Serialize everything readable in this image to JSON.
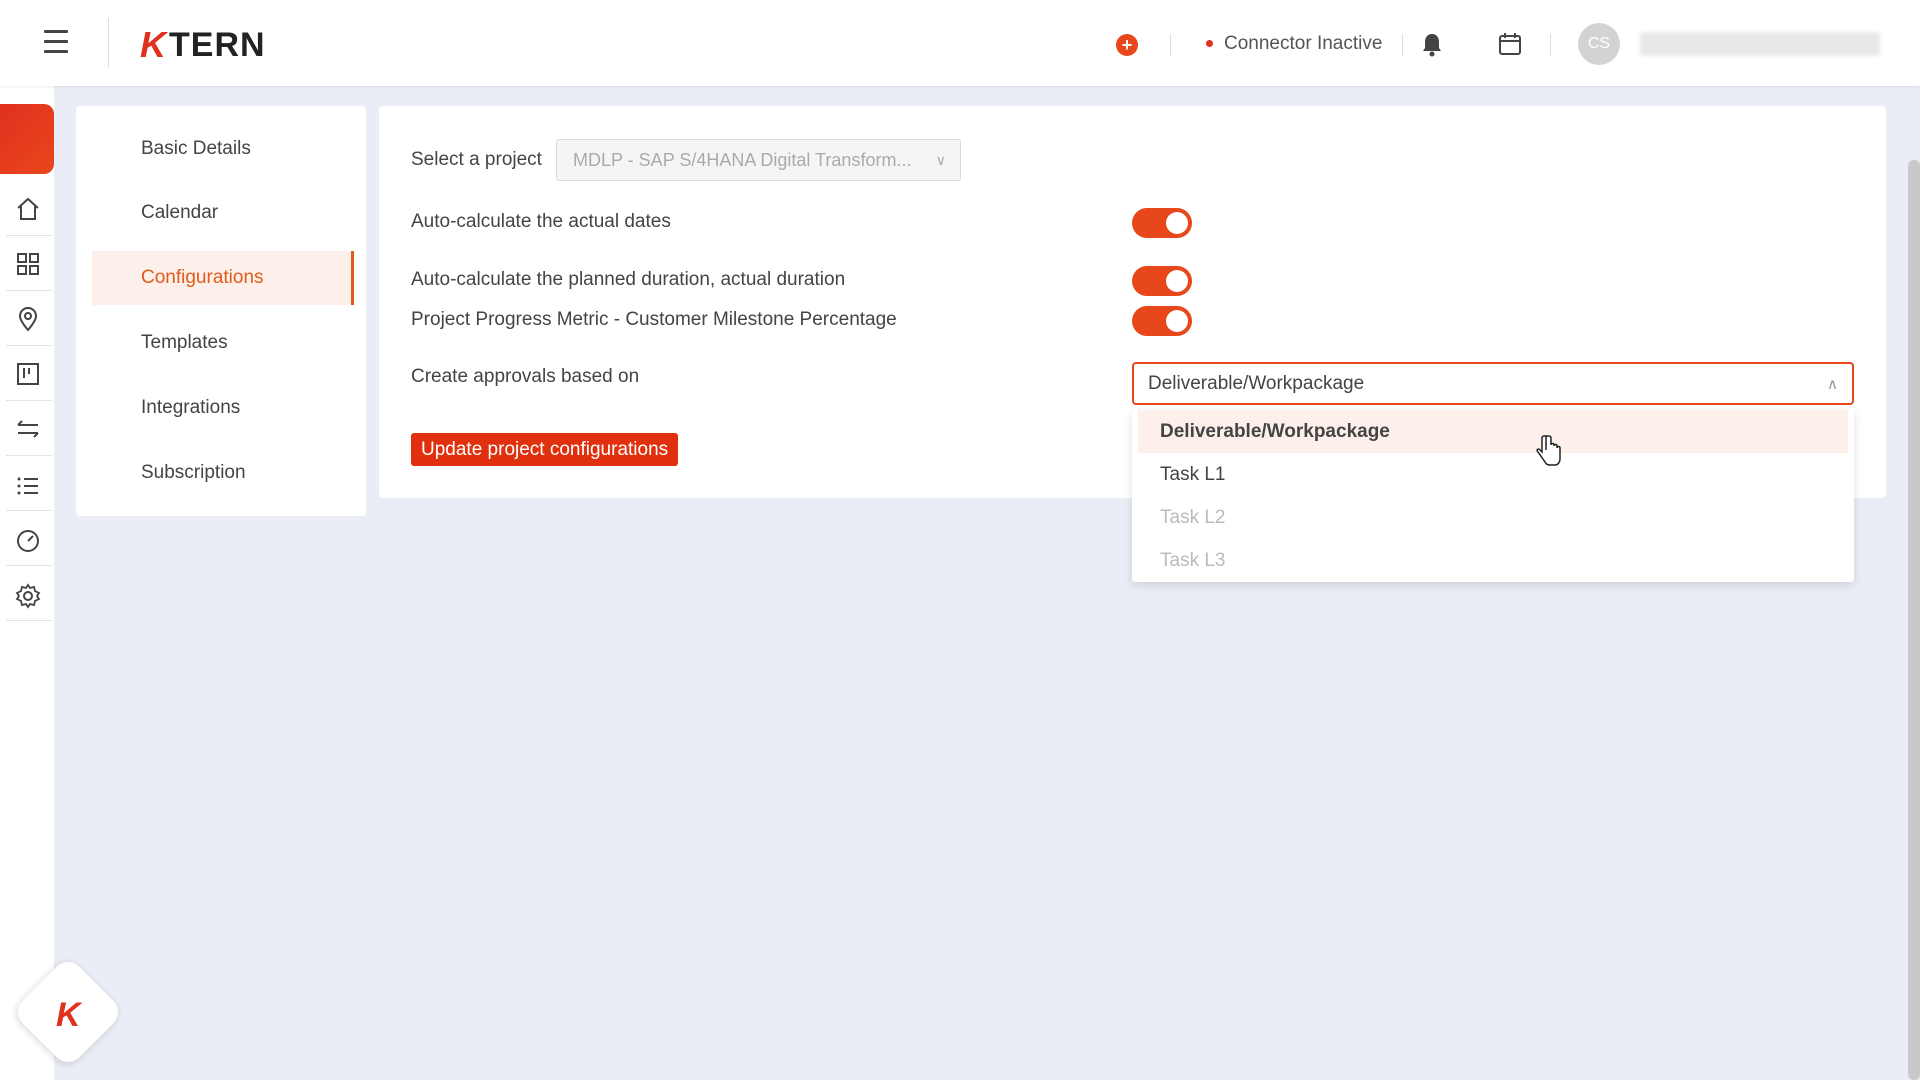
{
  "header": {
    "logo_k": "K",
    "logo_text": "TERN",
    "add_symbol": "+",
    "connector_status": "Connector Inactive",
    "avatar_initials": "CS",
    "status_color": "#e0301e",
    "accent": "#e8471c"
  },
  "sidebar_rail": {
    "icons": [
      "home-icon",
      "dashboard-grid-icon",
      "location-pin-icon",
      "board-icon",
      "transfer-arrows-icon",
      "list-icon",
      "speedometer-icon",
      "settings-gear-icon"
    ]
  },
  "settings_menu": {
    "items": [
      {
        "label": "Basic Details"
      },
      {
        "label": "Calendar"
      },
      {
        "label": "Configurations"
      },
      {
        "label": "Templates"
      },
      {
        "label": "Integrations"
      },
      {
        "label": "Subscription"
      }
    ],
    "active": "Configurations"
  },
  "config": {
    "select_project_label": "Select a project",
    "project_value": "MDLP - SAP S/4HANA Digital Transform...",
    "auto_actual_dates_label": "Auto-calculate the actual dates",
    "auto_actual_dates_on": true,
    "auto_duration_label": "Auto-calculate the planned duration, actual duration",
    "auto_duration_on": true,
    "progress_metric_label": "Project Progress Metric - Customer Milestone Percentage",
    "progress_metric_on": true,
    "approvals_label": "Create approvals based on",
    "approvals_value": "Deliverable/Workpackage",
    "update_button": "Update project configurations"
  },
  "approvals_dropdown": {
    "options": [
      {
        "label": "Deliverable/Workpackage",
        "state": "selected"
      },
      {
        "label": "Task L1",
        "state": "enabled"
      },
      {
        "label": "Task L2",
        "state": "disabled"
      },
      {
        "label": "Task L3",
        "state": "disabled"
      }
    ]
  },
  "fab": {
    "label": "K"
  }
}
